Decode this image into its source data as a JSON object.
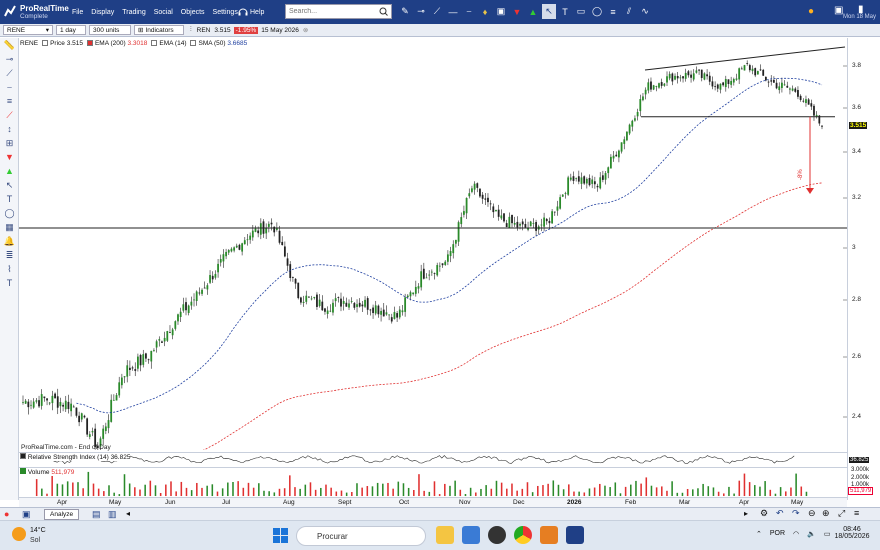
{
  "app": {
    "name": "ProRealTime",
    "plan": "Complete"
  },
  "menu": [
    "File",
    "Display",
    "Trading",
    "Social",
    "Objects",
    "Settings"
  ],
  "help": "Help",
  "search": {
    "placeholder": "Search..."
  },
  "datetime": "Mon 18 May",
  "toolbar": {
    "ticker": "RENE",
    "timeframe": "1 day",
    "units": "300 units",
    "indicators": "Indicators",
    "quote_symbol": "REN",
    "quote_price": "3.515",
    "quote_change": "-1.95%",
    "quote_date": "15 May 2026"
  },
  "legend": {
    "price_label": "Price",
    "price_value": "3.515",
    "ema200_label": "EMA (200)",
    "ema200_value": "3.3018",
    "ema14_label": "EMA (14)",
    "sma50_label": "SMA (50)",
    "sma50_value": "3.6685"
  },
  "price_axis": [
    "3.8",
    "3.6",
    "3.4",
    "3.2",
    "3",
    "2.8",
    "2.6",
    "2.4"
  ],
  "price_current": "3.515",
  "source": "ProRealTime.com - End of Day",
  "annotation_pct": "-8%",
  "rsi": {
    "label": "Relative Strength Index (14)",
    "value": "36.825"
  },
  "volume": {
    "label": "Volume",
    "value": "511,979",
    "ticks": [
      "3.000k",
      "2.000k",
      "1.000k"
    ]
  },
  "months": [
    "Apr",
    "May",
    "Jun",
    "Jul",
    "Aug",
    "Sept",
    "Oct",
    "Nov",
    "Dec",
    "2026",
    "Feb",
    "Mar",
    "Apr",
    "May"
  ],
  "status": {
    "analyze": "Analyze"
  },
  "taskbar": {
    "temp": "14°C",
    "cond": "Sol",
    "search": "Procurar",
    "lang": "POR",
    "time": "08:46",
    "date": "18/05/2026"
  },
  "colors": {
    "accent": "#1f3f86",
    "up": "#2a8a2a",
    "down": "#222222",
    "ema200": "#e03030",
    "sma50": "#2040a0",
    "change_bg": "#e04040"
  },
  "chart_data": {
    "type": "candlestick",
    "x_label": "date",
    "y_range": [
      2.3,
      3.9
    ],
    "months": [
      "Apr",
      "May",
      "Jun",
      "Jul",
      "Aug",
      "Sept",
      "Oct",
      "Nov",
      "Dec",
      "2026",
      "Feb",
      "Mar",
      "Apr",
      "May"
    ],
    "approx_closes": [
      2.45,
      2.46,
      2.44,
      2.3,
      2.55,
      2.6,
      2.72,
      2.82,
      2.95,
      3.05,
      3.1,
      2.82,
      2.78,
      2.8,
      2.78,
      2.74,
      2.9,
      2.95,
      3.25,
      3.12,
      3.08,
      3.1,
      3.3,
      3.25,
      3.45,
      3.7,
      3.75,
      3.76,
      3.7,
      3.8,
      3.72,
      3.68,
      3.515
    ],
    "support_level": 3.08,
    "resistance_level": 3.56
  }
}
